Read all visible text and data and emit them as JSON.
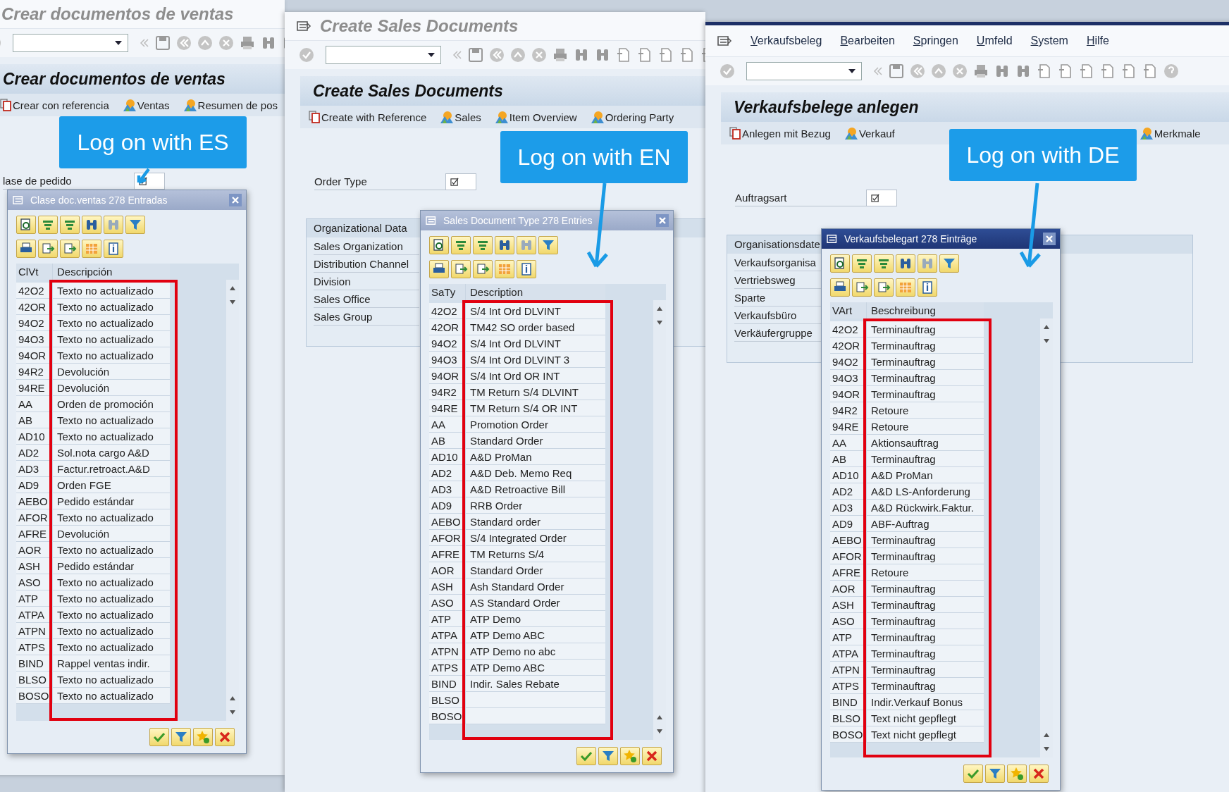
{
  "windows": [
    {
      "title": "Crear documentos de ventas",
      "screen_title": "Crear documentos de ventas",
      "app_toolbar": [
        {
          "kind": "reference",
          "label": "Crear con referencia"
        },
        {
          "kind": "nav",
          "label": "Ventas"
        },
        {
          "kind": "nav",
          "label": "Resumen de pos"
        }
      ],
      "field": {
        "label": "lase de pedido"
      },
      "popup": {
        "title": "Clase doc.ventas 278 Entradas",
        "active": false,
        "columns": [
          "ClVt",
          "Descripción"
        ],
        "rows": [
          {
            "code": "42O2",
            "description": "Texto no actualizado"
          },
          {
            "code": "42OR",
            "description": "Texto no actualizado"
          },
          {
            "code": "94O2",
            "description": "Texto no actualizado"
          },
          {
            "code": "94O3",
            "description": "Texto no actualizado"
          },
          {
            "code": "94OR",
            "description": "Texto no actualizado"
          },
          {
            "code": "94R2",
            "description": "Devolución"
          },
          {
            "code": "94RE",
            "description": "Devolución"
          },
          {
            "code": "AA",
            "description": "Orden de promoción"
          },
          {
            "code": "AB",
            "description": "Texto no actualizado"
          },
          {
            "code": "AD10",
            "description": "Texto no actualizado"
          },
          {
            "code": "AD2",
            "description": "Sol.nota cargo A&D"
          },
          {
            "code": "AD3",
            "description": "Factur.retroact.A&D"
          },
          {
            "code": "AD9",
            "description": "Orden FGE"
          },
          {
            "code": "AEBO",
            "description": "Pedido estándar"
          },
          {
            "code": "AFOR",
            "description": "Texto no actualizado"
          },
          {
            "code": "AFRE",
            "description": "Devolución"
          },
          {
            "code": "AOR",
            "description": "Texto no actualizado"
          },
          {
            "code": "ASH",
            "description": "Pedido estándar"
          },
          {
            "code": "ASO",
            "description": "Texto no actualizado"
          },
          {
            "code": "ATP",
            "description": "Texto no actualizado"
          },
          {
            "code": "ATPA",
            "description": "Texto no actualizado"
          },
          {
            "code": "ATPN",
            "description": "Texto no actualizado"
          },
          {
            "code": "ATPS",
            "description": "Texto no actualizado"
          },
          {
            "code": "BIND",
            "description": "Rappel ventas indir."
          },
          {
            "code": "BLSO",
            "description": "Texto no actualizado"
          },
          {
            "code": "BOSO",
            "description": "Texto no actualizado"
          }
        ]
      }
    },
    {
      "title": "Create Sales Documents",
      "screen_title": "Create Sales Documents",
      "app_toolbar": [
        {
          "kind": "reference",
          "label": "Create with Reference"
        },
        {
          "kind": "nav",
          "label": "Sales"
        },
        {
          "kind": "nav",
          "label": "Item Overview"
        },
        {
          "kind": "nav",
          "label": "Ordering Party"
        }
      ],
      "field": {
        "label": "Order Type"
      },
      "org_group": {
        "title": "Organizational Data",
        "fields": [
          "Sales Organization",
          "Distribution Channel",
          "Division",
          "Sales Office",
          "Sales Group"
        ]
      },
      "popup": {
        "title": "Sales Document Type 278 Entries",
        "active": false,
        "columns": [
          "SaTy",
          "Description"
        ],
        "rows": [
          {
            "code": "42O2",
            "description": "S/4 Int Ord DLVINT"
          },
          {
            "code": "42OR",
            "description": "TM42 SO order based"
          },
          {
            "code": "94O2",
            "description": "S/4 Int Ord DLVINT"
          },
          {
            "code": "94O3",
            "description": "S/4 Int Ord DLVINT 3"
          },
          {
            "code": "94OR",
            "description": "S/4 Int Ord OR INT"
          },
          {
            "code": "94R2",
            "description": "TM Return S/4 DLVINT"
          },
          {
            "code": "94RE",
            "description": "TM Return S/4 OR INT"
          },
          {
            "code": "AA",
            "description": "Promotion Order"
          },
          {
            "code": "AB",
            "description": "Standard Order"
          },
          {
            "code": "AD10",
            "description": "A&D ProMan"
          },
          {
            "code": "AD2",
            "description": "A&D Deb. Memo Req"
          },
          {
            "code": "AD3",
            "description": "A&D Retroactive Bill"
          },
          {
            "code": "AD9",
            "description": "RRB Order"
          },
          {
            "code": "AEBO",
            "description": "Standard order"
          },
          {
            "code": "AFOR",
            "description": "S/4 Integrated Order"
          },
          {
            "code": "AFRE",
            "description": "TM Returns S/4"
          },
          {
            "code": "AOR",
            "description": "Standard Order"
          },
          {
            "code": "ASH",
            "description": "Ash Standard Order"
          },
          {
            "code": "ASO",
            "description": "AS Standard Order"
          },
          {
            "code": "ATP",
            "description": "ATP Demo"
          },
          {
            "code": "ATPA",
            "description": "ATP Demo ABC"
          },
          {
            "code": "ATPN",
            "description": "ATP Demo no abc"
          },
          {
            "code": "ATPS",
            "description": "ATP Demo ABC"
          },
          {
            "code": "BIND",
            "description": "Indir. Sales Rebate"
          },
          {
            "code": "BLSO"
          },
          {
            "code": "BOSO"
          }
        ]
      }
    },
    {
      "menu": [
        "Verkaufsbeleg",
        "Bearbeiten",
        "Springen",
        "Umfeld",
        "System",
        "Hilfe"
      ],
      "screen_title": "Verkaufsbelege anlegen",
      "app_toolbar": [
        {
          "kind": "reference",
          "label": "Anlegen mit Bezug"
        },
        {
          "kind": "nav",
          "label": "Verkauf"
        },
        {
          "kind": "nav",
          "label": "Merkmale"
        }
      ],
      "field": {
        "label": "Auftragsart"
      },
      "org_group": {
        "title": "Organisationsdate",
        "fields": [
          "Verkaufsorganisa",
          "Vertriebsweg",
          "Sparte",
          "Verkaufsbüro",
          "Verkäufergruppe"
        ]
      },
      "popup": {
        "title": "Verkaufsbelegart 278 Einträge",
        "active": true,
        "columns": [
          "VArt",
          "Beschreibung"
        ],
        "rows": [
          {
            "code": "42O2",
            "description": "Terminauftrag"
          },
          {
            "code": "42OR",
            "description": "Terminauftrag"
          },
          {
            "code": "94O2",
            "description": "Terminauftrag"
          },
          {
            "code": "94O3",
            "description": "Terminauftrag"
          },
          {
            "code": "94OR",
            "description": "Terminauftrag"
          },
          {
            "code": "94R2",
            "description": "Retoure"
          },
          {
            "code": "94RE",
            "description": "Retoure"
          },
          {
            "code": "AA",
            "description": "Aktionsauftrag"
          },
          {
            "code": "AB",
            "description": "Terminauftrag"
          },
          {
            "code": "AD10",
            "description": "A&D ProMan"
          },
          {
            "code": "AD2",
            "description": "A&D LS-Anforderung"
          },
          {
            "code": "AD3",
            "description": "A&D Rückwirk.Faktur."
          },
          {
            "code": "AD9",
            "description": "ABF-Auftrag"
          },
          {
            "code": "AEBO",
            "description": "Terminauftrag"
          },
          {
            "code": "AFOR",
            "description": "Terminauftrag"
          },
          {
            "code": "AFRE",
            "description": "Retoure"
          },
          {
            "code": "AOR",
            "description": "Terminauftrag"
          },
          {
            "code": "ASH",
            "description": "Terminauftrag"
          },
          {
            "code": "ASO",
            "description": "Terminauftrag"
          },
          {
            "code": "ATP",
            "description": "Terminauftrag"
          },
          {
            "code": "ATPA",
            "description": "Terminauftrag"
          },
          {
            "code": "ATPN",
            "description": "Terminauftrag"
          },
          {
            "code": "ATPS",
            "description": "Terminauftrag"
          },
          {
            "code": "BIND",
            "description": "Indir.Verkauf Bonus"
          },
          {
            "code": "BLSO",
            "description": "Text nicht gepflegt"
          },
          {
            "code": "BOSO",
            "description": "Text nicht gepflegt"
          }
        ]
      }
    }
  ],
  "callouts": [
    {
      "text": "Log on with ES"
    },
    {
      "text": "Log on with EN"
    },
    {
      "text": "Log on with DE"
    }
  ]
}
